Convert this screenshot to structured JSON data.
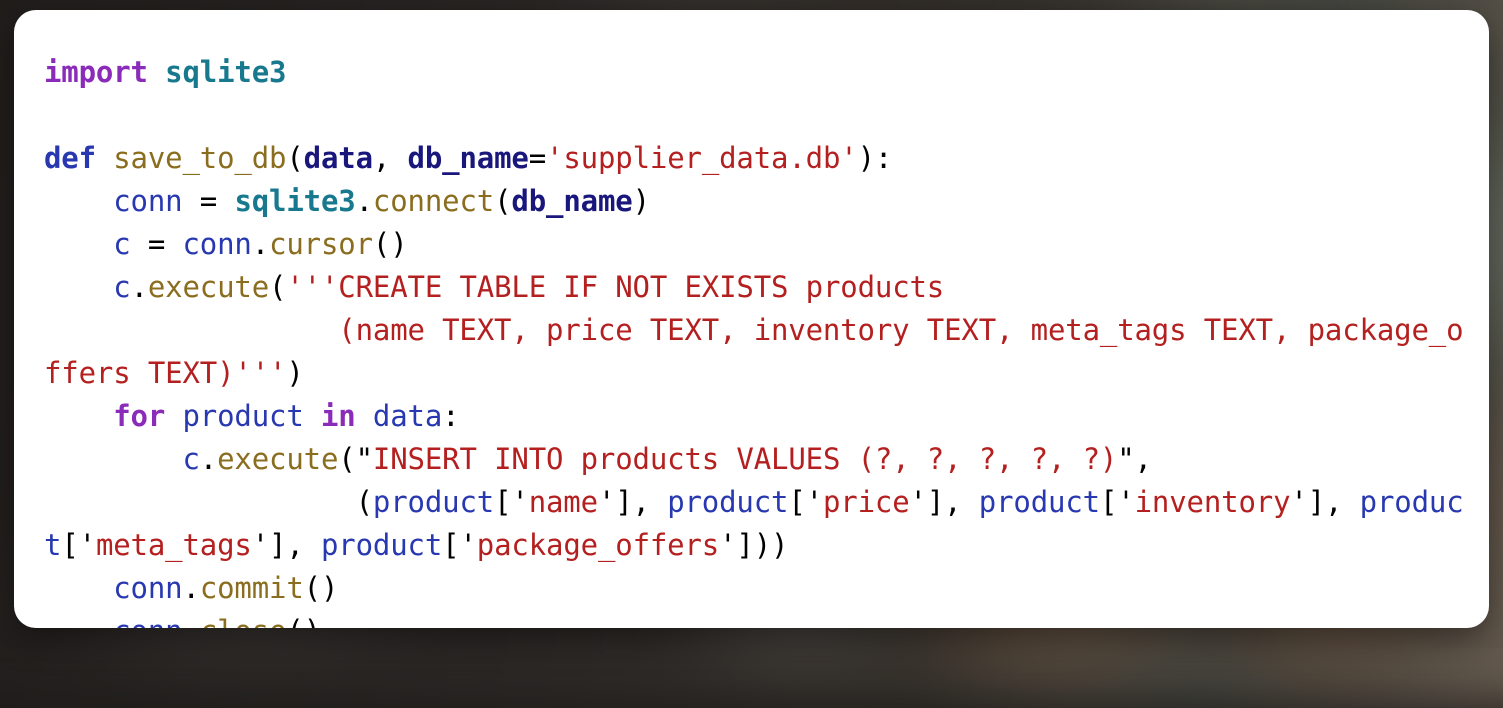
{
  "card": {
    "background_color": "#ffffff",
    "corner_radius_px": 22,
    "language": "python",
    "theme": "light"
  },
  "backdrop": {
    "kind": "blurred-photo",
    "base_color": "#272320",
    "accent_colors": [
      "#6d5f52",
      "#43453f",
      "#201d1b"
    ]
  },
  "syntax_colors": {
    "keyword": "#8b2bb9",
    "keyword_def": "#2838b0",
    "function_name": "#8a6d1e",
    "module": "#17788e",
    "variable": "#2838b0",
    "parameter": "#19177c",
    "string": "#b4201f",
    "punctuation": "#000000"
  },
  "code": {
    "plain_text": "import sqlite3\n\ndef save_to_db(data, db_name='supplier_data.db'):\n    conn = sqlite3.connect(db_name)\n    c = conn.cursor()\n    c.execute('''CREATE TABLE IF NOT EXISTS products\n                 (name TEXT, price TEXT, inventory TEXT, meta_tags TEXT, package_offers TEXT)''')\n    for product in data:\n        c.execute(\"INSERT INTO products VALUES (?, ?, ?, ?, ?)\",\n                  (product['name'], product['price'], product['inventory'], product['meta_tags'], product['package_offers']))\n    conn.commit()\n    conn.close()",
    "lines": [
      {
        "id": "line-import",
        "tokens": [
          {
            "t": "import",
            "c": "kw"
          },
          {
            "t": " ",
            "c": "punc"
          },
          {
            "t": "sqlite3",
            "c": "mod"
          }
        ]
      },
      {
        "id": "line-blank",
        "tokens": [
          {
            "t": "",
            "c": "punc"
          }
        ]
      },
      {
        "id": "line-def",
        "tokens": [
          {
            "t": "def",
            "c": "kw2"
          },
          {
            "t": " ",
            "c": "punc"
          },
          {
            "t": "save_to_db",
            "c": "name"
          },
          {
            "t": "(",
            "c": "punc"
          },
          {
            "t": "data",
            "c": "param"
          },
          {
            "t": ", ",
            "c": "punc"
          },
          {
            "t": "db_name",
            "c": "param"
          },
          {
            "t": "=",
            "c": "punc"
          },
          {
            "t": "'supplier_data.db'",
            "c": "str"
          },
          {
            "t": "):",
            "c": "punc"
          }
        ]
      },
      {
        "id": "line-conn",
        "tokens": [
          {
            "t": "    ",
            "c": "punc"
          },
          {
            "t": "conn",
            "c": "var"
          },
          {
            "t": " = ",
            "c": "punc"
          },
          {
            "t": "sqlite3",
            "c": "mod"
          },
          {
            "t": ".",
            "c": "punc"
          },
          {
            "t": "connect",
            "c": "name"
          },
          {
            "t": "(",
            "c": "punc"
          },
          {
            "t": "db_name",
            "c": "param"
          },
          {
            "t": ")",
            "c": "punc"
          }
        ]
      },
      {
        "id": "line-cursor",
        "tokens": [
          {
            "t": "    ",
            "c": "punc"
          },
          {
            "t": "c",
            "c": "var"
          },
          {
            "t": " = ",
            "c": "punc"
          },
          {
            "t": "conn",
            "c": "var"
          },
          {
            "t": ".",
            "c": "punc"
          },
          {
            "t": "cursor",
            "c": "name"
          },
          {
            "t": "()",
            "c": "punc"
          }
        ]
      },
      {
        "id": "line-create-table",
        "tokens": [
          {
            "t": "    ",
            "c": "punc"
          },
          {
            "t": "c",
            "c": "var"
          },
          {
            "t": ".",
            "c": "punc"
          },
          {
            "t": "execute",
            "c": "name"
          },
          {
            "t": "(",
            "c": "punc"
          },
          {
            "t": "'''CREATE TABLE IF NOT EXISTS products\n                 (name TEXT, price TEXT, inventory TEXT, meta_tags TEXT, package_offers TEXT)'''",
            "c": "str"
          },
          {
            "t": ")",
            "c": "punc"
          }
        ]
      },
      {
        "id": "line-for",
        "tokens": [
          {
            "t": "    ",
            "c": "punc"
          },
          {
            "t": "for",
            "c": "kw"
          },
          {
            "t": " ",
            "c": "punc"
          },
          {
            "t": "product",
            "c": "var"
          },
          {
            "t": " ",
            "c": "punc"
          },
          {
            "t": "in",
            "c": "kw"
          },
          {
            "t": " ",
            "c": "punc"
          },
          {
            "t": "data",
            "c": "var"
          },
          {
            "t": ":",
            "c": "punc"
          }
        ]
      },
      {
        "id": "line-insert",
        "tokens": [
          {
            "t": "        ",
            "c": "punc"
          },
          {
            "t": "c",
            "c": "var"
          },
          {
            "t": ".",
            "c": "punc"
          },
          {
            "t": "execute",
            "c": "name"
          },
          {
            "t": "(\"",
            "c": "punc"
          },
          {
            "t": "INSERT INTO products VALUES (?, ?, ?, ?, ?)",
            "c": "str"
          },
          {
            "t": "\",",
            "c": "punc"
          }
        ]
      },
      {
        "id": "line-values",
        "tokens": [
          {
            "t": "                  (",
            "c": "punc"
          },
          {
            "t": "product",
            "c": "var"
          },
          {
            "t": "['",
            "c": "punc"
          },
          {
            "t": "name",
            "c": "str"
          },
          {
            "t": "'], ",
            "c": "punc"
          },
          {
            "t": "product",
            "c": "var"
          },
          {
            "t": "['",
            "c": "punc"
          },
          {
            "t": "price",
            "c": "str"
          },
          {
            "t": "'], ",
            "c": "punc"
          },
          {
            "t": "product",
            "c": "var"
          },
          {
            "t": "['",
            "c": "punc"
          },
          {
            "t": "inventory",
            "c": "str"
          },
          {
            "t": "'], ",
            "c": "punc"
          },
          {
            "t": "product",
            "c": "var"
          },
          {
            "t": "['",
            "c": "punc"
          },
          {
            "t": "meta_tags",
            "c": "str"
          },
          {
            "t": "'], ",
            "c": "punc"
          },
          {
            "t": "product",
            "c": "var"
          },
          {
            "t": "['",
            "c": "punc"
          },
          {
            "t": "package_offers",
            "c": "str"
          },
          {
            "t": "']))",
            "c": "punc"
          }
        ]
      },
      {
        "id": "line-commit",
        "tokens": [
          {
            "t": "    ",
            "c": "punc"
          },
          {
            "t": "conn",
            "c": "var"
          },
          {
            "t": ".",
            "c": "punc"
          },
          {
            "t": "commit",
            "c": "name"
          },
          {
            "t": "()",
            "c": "punc"
          }
        ]
      },
      {
        "id": "line-close",
        "tokens": [
          {
            "t": "    ",
            "c": "punc"
          },
          {
            "t": "conn",
            "c": "var"
          },
          {
            "t": ".",
            "c": "punc"
          },
          {
            "t": "close",
            "c": "name"
          },
          {
            "t": "()",
            "c": "punc"
          }
        ]
      }
    ]
  }
}
